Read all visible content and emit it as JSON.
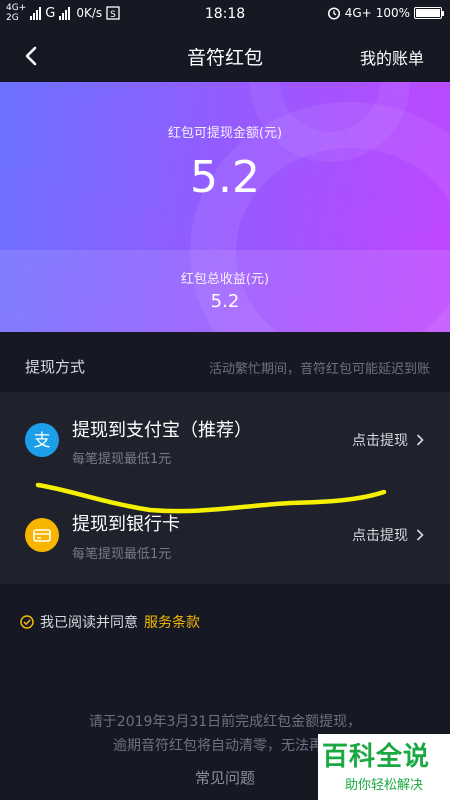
{
  "status_bar": {
    "network_top": "4G+",
    "network_bottom": "2G",
    "carrier2": "G",
    "speed": "0K/s",
    "time": "18:18",
    "network_right": "4G+",
    "battery": "100%"
  },
  "nav": {
    "title": "音符红包",
    "right_link": "我的账单"
  },
  "hero": {
    "withdrawable_label": "红包可提现金额(元)",
    "withdrawable_amount": "5.2",
    "total_label": "红包总收益(元)",
    "total_amount": "5.2"
  },
  "section": {
    "title": "提现方式",
    "note": "活动繁忙期间，音符红包可能延迟到账"
  },
  "options": [
    {
      "title": "提现到支付宝（推荐）",
      "subtitle": "每笔提现最低1元",
      "action": "点击提现",
      "icon": "alipay-icon",
      "color": "#1c9fe8"
    },
    {
      "title": "提现到银行卡",
      "subtitle": "每笔提现最低1元",
      "action": "点击提现",
      "icon": "bank-card-icon",
      "color": "#f7b500"
    }
  ],
  "agreement": {
    "text": "我已阅读并同意",
    "link": "服务条款"
  },
  "footer": {
    "line1": "请于2019年3月31日前完成红包金额提现，",
    "line2": "逾期音符红包将自动清零，无法再进",
    "faq": "常见问题"
  },
  "watermark": {
    "main": "百科全说",
    "sub": "助你轻松解决"
  },
  "colors": {
    "accent_link": "#f5b800",
    "background": "#161924",
    "card": "#1f222d",
    "annotation": "#f4f000"
  }
}
